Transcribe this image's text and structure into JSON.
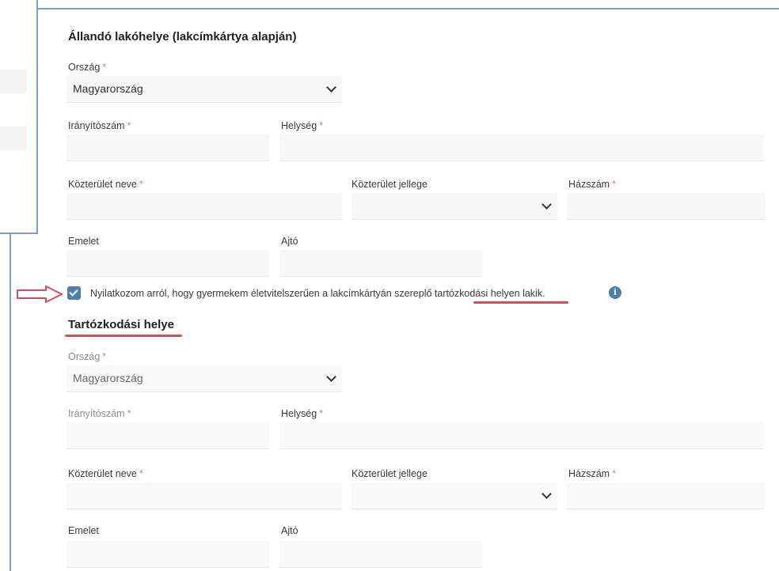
{
  "permanent": {
    "title": "Állandó lakóhelye (lakcímkártya alapján)",
    "country_label": "Ország",
    "country_value": "Magyarország",
    "zip_label": "Irányítószám",
    "city_label": "Helység",
    "street_label": "Közterület neve",
    "street_type_label": "Közterület jellege",
    "house_label": "Házszám",
    "floor_label": "Emelet",
    "door_label": "Ajtó"
  },
  "declaration": {
    "checked": true,
    "text_before": "Nyilatkozom arról, hogy gyermekem életvitelszerűen a lakcímkártyán szereplő ",
    "text_highlight": "tartózkodási helyen",
    "text_after": " lakik.",
    "info_icon": "i"
  },
  "residence": {
    "title": "Tartózkodási helye",
    "country_label": "Ország",
    "country_value": "Magyarország",
    "zip_label": "Irányítószám",
    "city_label": "Helység",
    "street_label": "Közterület neve",
    "street_type_label": "Közterület jellege",
    "house_label": "Házszám",
    "floor_label": "Emelet",
    "door_label": "Ajtó"
  },
  "required_mark": "*",
  "colors": {
    "accent": "#4b7fb0",
    "annotation_red": "#d64d5a",
    "frame": "#7aa0c4"
  }
}
